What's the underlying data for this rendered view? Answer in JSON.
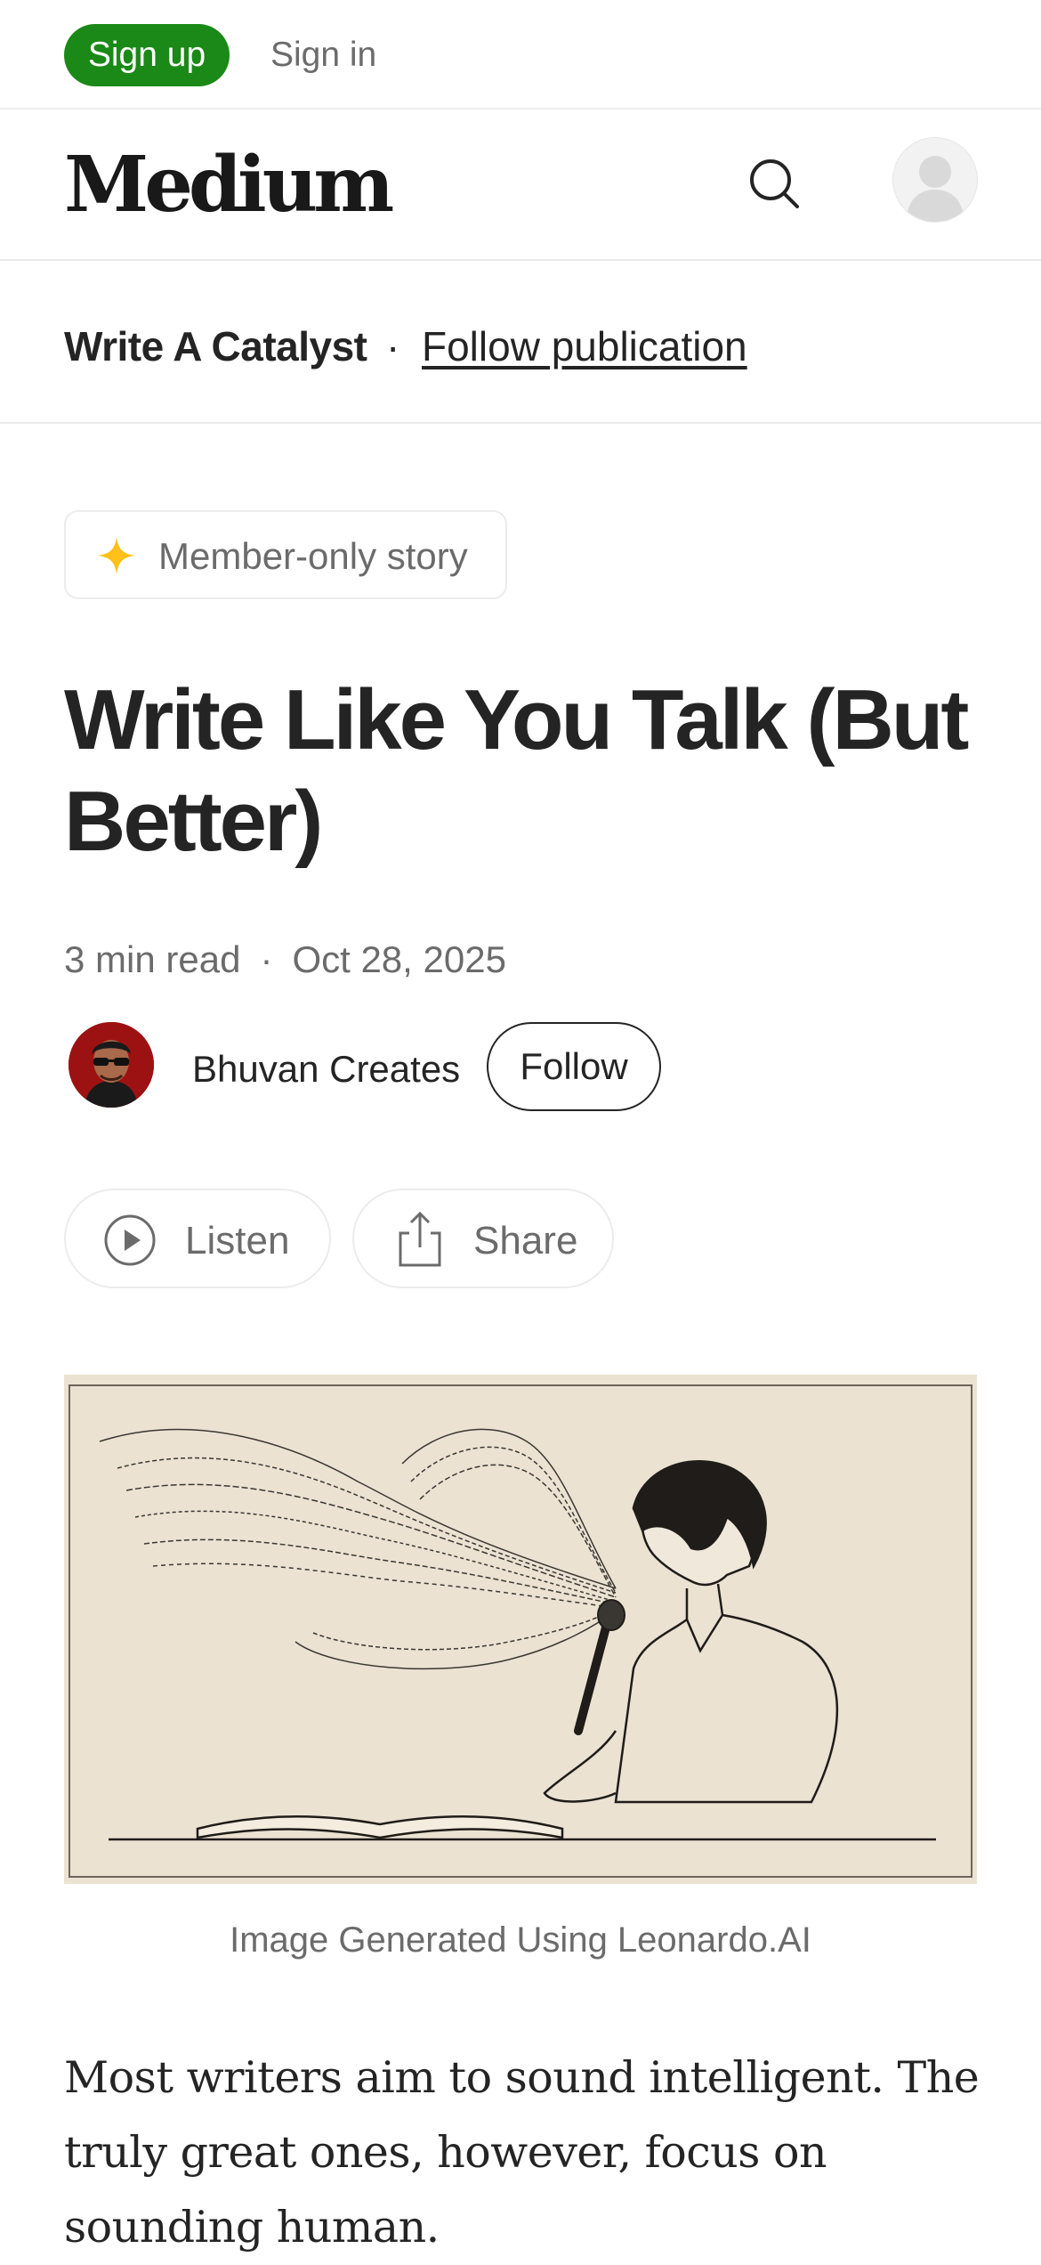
{
  "topbar": {
    "signup_label": "Sign up",
    "signin_label": "Sign in"
  },
  "masthead": {
    "logo": "Medium",
    "search_icon": "search-icon",
    "avatar_icon": "user-avatar-icon"
  },
  "publication": {
    "name": "Write A Catalyst",
    "separator": "·",
    "follow_label": "Follow publication"
  },
  "badge": {
    "label": "Member-only story",
    "icon": "sparkle-icon",
    "icon_color": "#ffc017"
  },
  "article": {
    "title": "Write Like You Talk (But Better)",
    "read_time": "3 min read",
    "meta_separator": "·",
    "date": "Oct 28, 2025",
    "author": "Bhuvan Creates",
    "follow_label": "Follow",
    "listen_label": "Listen",
    "share_label": "Share",
    "image_caption": "Image Generated Using Leonardo.AI",
    "body": "Most writers aim to sound intelligent. The truly great ones, however, focus on sounding human."
  },
  "colors": {
    "accent": "#1a8917",
    "text": "#242424",
    "muted": "#6b6b6b",
    "border": "#ececec"
  }
}
